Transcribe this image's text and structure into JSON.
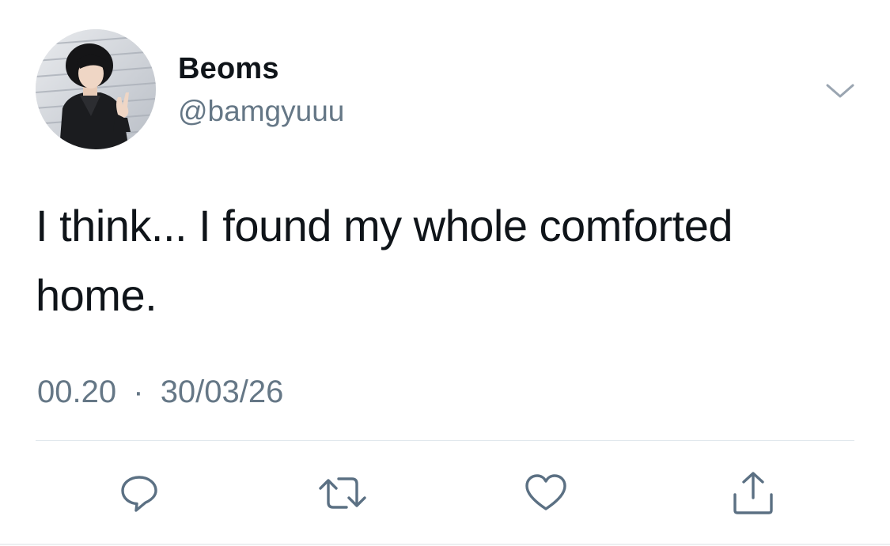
{
  "tweet": {
    "author": {
      "display_name": "Beoms",
      "handle": "@bamgyuuu"
    },
    "text": "I think... I found my whole comforted home.",
    "time": "00.20",
    "separator": "·",
    "date": "30/03/26"
  },
  "icons": {
    "more": "chevron-down-icon",
    "reply": "reply-icon",
    "retweet": "retweet-icon",
    "like": "heart-icon",
    "share": "share-icon"
  },
  "colors": {
    "text": "#0f1419",
    "secondary": "#657786",
    "icon": "#5b7083",
    "divider": "#e1e8ed"
  }
}
